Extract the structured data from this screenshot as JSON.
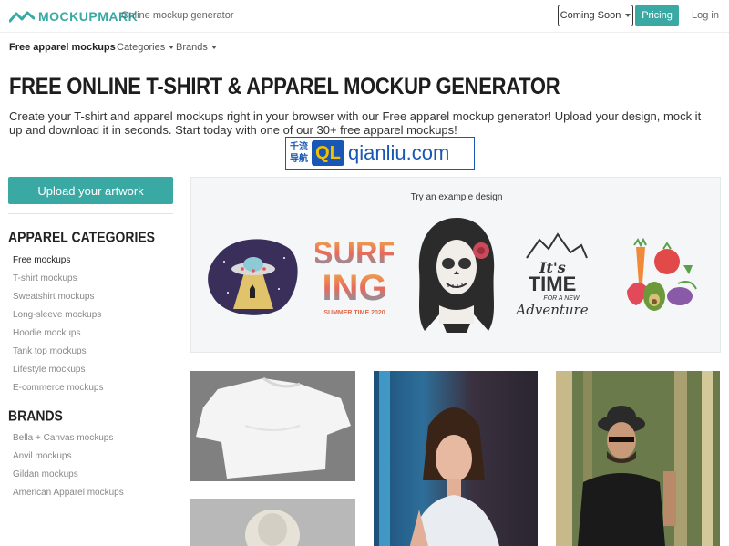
{
  "header": {
    "brand": "MOCKUPMARK",
    "tagline": "Online mockup generator",
    "coming_soon": "Coming Soon",
    "pricing": "Pricing",
    "login": "Log in",
    "accent_color": "#3aa9a3"
  },
  "subnav": {
    "active": "Free apparel mockups",
    "categories": "Categories",
    "brands": "Brands"
  },
  "hero": {
    "title": "FREE ONLINE T-SHIRT & APPAREL MOCKUP GENERATOR",
    "description": "Create your T-shirt and apparel mockups right in your browser with our Free apparel mockup generator! Upload your design, mock it up and download it in seconds. Start today with one of our 30+ free apparel mockups!"
  },
  "watermark": {
    "cn": "千流导航",
    "badge": "QL",
    "text": "qianliu.com"
  },
  "sidebar": {
    "upload": "Upload your artwork",
    "categories_heading": "APPAREL CATEGORIES",
    "categories": [
      "Free mockups",
      "T-shirt mockups",
      "Sweatshirt mockups",
      "Long-sleeve mockups",
      "Hoodie mockups",
      "Tank top mockups",
      "Lifestyle mockups",
      "E-commerce mockups"
    ],
    "brands_heading": "BRANDS",
    "brands": [
      "Bella + Canvas mockups",
      "Anvil mockups",
      "Gildan mockups",
      "American Apparel mockups"
    ]
  },
  "examples": {
    "title": "Try an example design",
    "designs": [
      "ufo-design",
      "surfing-design",
      "skull-girl-design",
      "adventure-design",
      "vegetables-design"
    ],
    "surf_line1": "SURF",
    "surf_line2": "ING",
    "surf_sub": "SUMMER TIME 2020",
    "adv_line1": "It's",
    "adv_line2": "TIME",
    "adv_line3": "FOR A NEW",
    "adv_line4": "Adventure"
  }
}
